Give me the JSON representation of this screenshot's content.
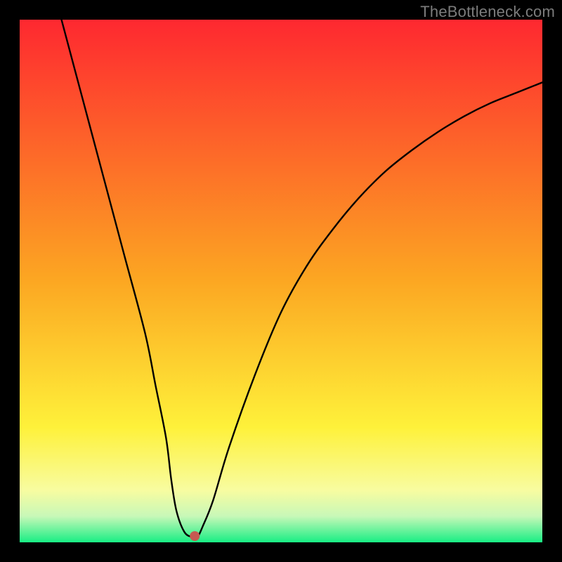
{
  "watermark": "TheBottleneck.com",
  "chart_data": {
    "type": "line",
    "title": "",
    "xlabel": "",
    "ylabel": "",
    "xlim": [
      0,
      100
    ],
    "ylim": [
      0,
      100
    ],
    "grid": false,
    "legend": false,
    "background_gradient": {
      "top_color": "#fe2830",
      "mid_color": "#fee838",
      "bottom_color": "#18ee84"
    },
    "series": [
      {
        "name": "bottleneck-curve",
        "type": "line",
        "x": [
          8,
          12,
          16,
          20,
          24,
          26,
          28,
          29,
          30,
          31.5,
          33,
          34,
          35,
          37,
          40,
          45,
          50,
          55,
          60,
          65,
          70,
          75,
          80,
          85,
          90,
          95,
          100
        ],
        "y": [
          100,
          85,
          70,
          55,
          40,
          30,
          20,
          12,
          6,
          2,
          1,
          1,
          3,
          8,
          18,
          32,
          44,
          53,
          60,
          66,
          71,
          75,
          78.5,
          81.5,
          84,
          86,
          88
        ]
      }
    ],
    "marker": {
      "x": 33.5,
      "y": 1.2,
      "color": "#c75a52",
      "radius_px": 7
    }
  }
}
